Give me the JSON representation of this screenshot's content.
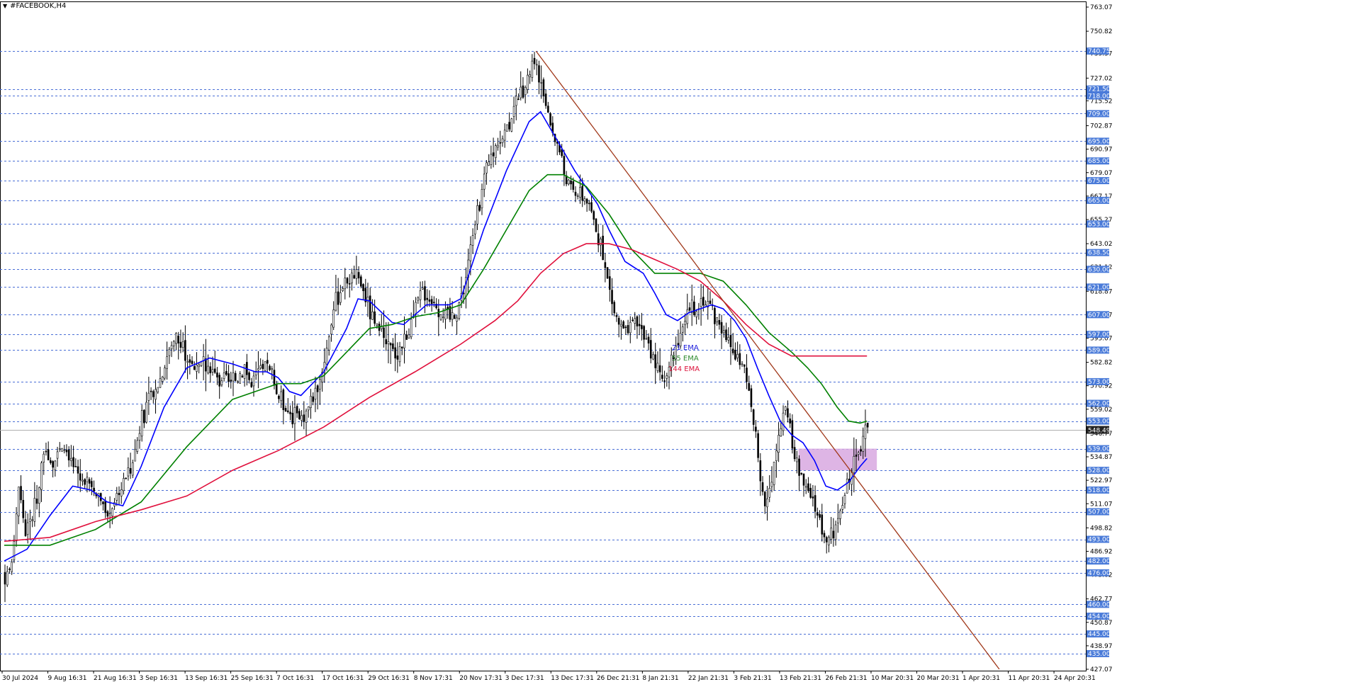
{
  "window": {
    "title": "#FACEBOOK,H4",
    "menu_icon": "triangle-down-icon"
  },
  "chart_data": {
    "type": "candlestick",
    "symbol": "#FACEBOOK",
    "timeframe": "H4",
    "current_price": "548.49",
    "ylim": [
      427.07,
      763.07
    ],
    "price_scale_ticks": [
      "763.07",
      "750.82",
      "739.57",
      "727.02",
      "715.52",
      "702.87",
      "690.97",
      "679.07",
      "667.17",
      "655.27",
      "643.02",
      "631.12",
      "618.87",
      "606.97",
      "595.07",
      "582.82",
      "570.92",
      "559.02",
      "546.77",
      "534.87",
      "522.97",
      "511.07",
      "498.82",
      "486.92",
      "475.02",
      "462.77",
      "450.87",
      "438.97",
      "427.07"
    ],
    "price_scale_tick_values": [
      763.07,
      750.82,
      739.57,
      727.02,
      715.52,
      702.87,
      690.97,
      679.07,
      667.17,
      655.27,
      643.02,
      631.12,
      618.87,
      606.97,
      595.07,
      582.82,
      570.92,
      559.02,
      546.77,
      534.87,
      522.97,
      511.07,
      498.82,
      486.92,
      475.02,
      462.77,
      450.87,
      438.97,
      427.07
    ],
    "horizontal_levels": [
      "740.75",
      "721.50",
      "718.00",
      "709.00",
      "695.00",
      "685.00",
      "675.00",
      "665.00",
      "653.00",
      "638.50",
      "630.00",
      "621.00",
      "607.00",
      "597.00",
      "589.00",
      "573.00",
      "562.00",
      "553.00",
      "539.00",
      "528.00",
      "518.00",
      "507.00",
      "493.00",
      "482.00",
      "476.00",
      "460.00",
      "454.00",
      "445.00",
      "435.00"
    ],
    "horizontal_level_values": [
      740.75,
      721.5,
      718.0,
      709.0,
      695.0,
      685.0,
      675.0,
      665.0,
      653.0,
      638.5,
      630.0,
      621.0,
      607.0,
      597.0,
      589.0,
      573.0,
      562.0,
      553.0,
      539.0,
      528.0,
      518.0,
      507.0,
      493.0,
      482.0,
      476.0,
      460.0,
      454.0,
      445.0,
      435.0
    ],
    "time_labels": [
      "30 Jul 2024",
      "9 Aug 16:31",
      "21 Aug 16:31",
      "3 Sep 16:31",
      "13 Sep 16:31",
      "25 Sep 16:31",
      "7 Oct 16:31",
      "17 Oct 16:31",
      "29 Oct 16:31",
      "8 Nov 17:31",
      "20 Nov 17:31",
      "3 Dec 17:31",
      "13 Dec 17:31",
      "26 Dec 21:31",
      "8 Jan 21:31",
      "22 Jan 21:31",
      "3 Feb 21:31",
      "13 Feb 21:31",
      "26 Feb 21:31",
      "10 Mar 20:31",
      "20 Mar 20:31",
      "1 Apr 20:31",
      "11 Apr 20:31",
      "24 Apr 20:31"
    ],
    "price_path": [
      [
        0,
        475
      ],
      [
        3,
        480
      ],
      [
        6,
        520
      ],
      [
        9,
        497
      ],
      [
        12,
        505
      ],
      [
        15,
        520
      ],
      [
        18,
        540
      ],
      [
        21,
        532
      ],
      [
        24,
        538
      ],
      [
        27,
        535
      ],
      [
        30,
        528
      ],
      [
        33,
        524
      ],
      [
        36,
        522
      ],
      [
        39,
        518
      ],
      [
        42,
        510
      ],
      [
        45,
        505
      ],
      [
        48,
        514
      ],
      [
        51,
        520
      ],
      [
        54,
        528
      ],
      [
        57,
        538
      ],
      [
        60,
        555
      ],
      [
        63,
        562
      ],
      [
        66,
        568
      ],
      [
        69,
        578
      ],
      [
        72,
        590
      ],
      [
        75,
        596
      ],
      [
        78,
        590
      ],
      [
        81,
        584
      ],
      [
        84,
        578
      ],
      [
        87,
        582
      ],
      [
        90,
        580
      ],
      [
        93,
        574
      ],
      [
        96,
        575
      ],
      [
        99,
        572
      ],
      [
        102,
        575
      ],
      [
        105,
        582
      ],
      [
        108,
        570
      ],
      [
        111,
        578
      ],
      [
        114,
        582
      ],
      [
        117,
        575
      ],
      [
        120,
        565
      ],
      [
        123,
        560
      ],
      [
        126,
        556
      ],
      [
        129,
        554
      ],
      [
        132,
        558
      ],
      [
        135,
        565
      ],
      [
        138,
        575
      ],
      [
        141,
        590
      ],
      [
        144,
        610
      ],
      [
        147,
        620
      ],
      [
        150,
        625
      ],
      [
        153,
        628
      ],
      [
        156,
        622
      ],
      [
        159,
        612
      ],
      [
        162,
        600
      ],
      [
        165,
        595
      ],
      [
        168,
        590
      ],
      [
        171,
        588
      ],
      [
        174,
        592
      ],
      [
        177,
        598
      ],
      [
        180,
        610
      ],
      [
        183,
        620
      ],
      [
        186,
        615
      ],
      [
        189,
        612
      ],
      [
        192,
        608
      ],
      [
        195,
        605
      ],
      [
        198,
        610
      ],
      [
        201,
        620
      ],
      [
        204,
        640
      ],
      [
        207,
        660
      ],
      [
        210,
        675
      ],
      [
        213,
        688
      ],
      [
        216,
        695
      ],
      [
        219,
        700
      ],
      [
        222,
        708
      ],
      [
        225,
        715
      ],
      [
        228,
        722
      ],
      [
        231,
        735
      ],
      [
        234,
        728
      ],
      [
        237,
        710
      ],
      [
        240,
        700
      ],
      [
        243,
        690
      ],
      [
        246,
        675
      ],
      [
        249,
        670
      ],
      [
        252,
        668
      ],
      [
        255,
        665
      ],
      [
        258,
        655
      ],
      [
        261,
        640
      ],
      [
        264,
        625
      ],
      [
        267,
        608
      ],
      [
        270,
        600
      ],
      [
        273,
        598
      ],
      [
        276,
        604
      ],
      [
        279,
        600
      ],
      [
        282,
        590
      ],
      [
        285,
        582
      ],
      [
        288,
        575
      ],
      [
        291,
        580
      ],
      [
        294,
        590
      ],
      [
        297,
        598
      ],
      [
        300,
        610
      ],
      [
        303,
        612
      ],
      [
        306,
        615
      ],
      [
        309,
        612
      ],
      [
        312,
        605
      ],
      [
        315,
        600
      ],
      [
        318,
        590
      ],
      [
        321,
        585
      ],
      [
        324,
        580
      ],
      [
        327,
        560
      ],
      [
        330,
        535
      ],
      [
        333,
        510
      ],
      [
        336,
        520
      ],
      [
        339,
        548
      ],
      [
        342,
        562
      ],
      [
        345,
        540
      ],
      [
        348,
        528
      ],
      [
        351,
        518
      ],
      [
        354,
        512
      ],
      [
        357,
        502
      ],
      [
        360,
        492
      ],
      [
        363,
        497
      ],
      [
        366,
        505
      ],
      [
        369,
        522
      ],
      [
        372,
        532
      ],
      [
        375,
        540
      ],
      [
        378,
        548.49
      ]
    ],
    "candle_count": 379,
    "series": [
      {
        "name": "21 EMA",
        "color": "#0000ff",
        "values": [
          [
            0,
            482
          ],
          [
            10,
            488
          ],
          [
            20,
            505
          ],
          [
            30,
            520
          ],
          [
            38,
            518
          ],
          [
            45,
            512
          ],
          [
            52,
            510
          ],
          [
            60,
            530
          ],
          [
            70,
            560
          ],
          [
            80,
            580
          ],
          [
            90,
            585
          ],
          [
            100,
            582
          ],
          [
            110,
            578
          ],
          [
            115,
            578
          ],
          [
            120,
            575
          ],
          [
            125,
            568
          ],
          [
            130,
            566
          ],
          [
            140,
            578
          ],
          [
            150,
            600
          ],
          [
            155,
            615
          ],
          [
            160,
            614
          ],
          [
            170,
            603
          ],
          [
            175,
            602
          ],
          [
            185,
            612
          ],
          [
            195,
            612
          ],
          [
            200,
            615
          ],
          [
            210,
            650
          ],
          [
            220,
            680
          ],
          [
            230,
            705
          ],
          [
            235,
            710
          ],
          [
            240,
            700
          ],
          [
            250,
            680
          ],
          [
            260,
            663
          ],
          [
            265,
            650
          ],
          [
            272,
            634
          ],
          [
            280,
            628
          ],
          [
            285,
            618
          ],
          [
            290,
            607
          ],
          [
            295,
            604
          ],
          [
            300,
            608
          ],
          [
            305,
            610
          ],
          [
            310,
            612
          ],
          [
            315,
            610
          ],
          [
            320,
            604
          ],
          [
            325,
            595
          ],
          [
            330,
            580
          ],
          [
            335,
            566
          ],
          [
            340,
            553
          ],
          [
            345,
            546
          ],
          [
            350,
            542
          ],
          [
            355,
            533
          ],
          [
            360,
            520
          ],
          [
            365,
            518
          ],
          [
            370,
            522
          ],
          [
            375,
            530
          ],
          [
            378,
            534
          ]
        ]
      },
      {
        "name": "55 EMA",
        "color": "#008000",
        "values": [
          [
            0,
            490
          ],
          [
            20,
            490
          ],
          [
            40,
            498
          ],
          [
            60,
            512
          ],
          [
            80,
            540
          ],
          [
            100,
            564
          ],
          [
            120,
            572
          ],
          [
            130,
            572
          ],
          [
            140,
            576
          ],
          [
            150,
            588
          ],
          [
            160,
            600
          ],
          [
            170,
            602
          ],
          [
            180,
            606
          ],
          [
            190,
            608
          ],
          [
            200,
            612
          ],
          [
            210,
            630
          ],
          [
            220,
            650
          ],
          [
            230,
            670
          ],
          [
            238,
            678
          ],
          [
            245,
            678
          ],
          [
            255,
            672
          ],
          [
            265,
            658
          ],
          [
            275,
            640
          ],
          [
            285,
            628
          ],
          [
            295,
            628
          ],
          [
            305,
            628
          ],
          [
            315,
            624
          ],
          [
            325,
            612
          ],
          [
            335,
            598
          ],
          [
            345,
            588
          ],
          [
            352,
            580
          ],
          [
            358,
            572
          ],
          [
            365,
            560
          ],
          [
            370,
            553
          ],
          [
            375,
            552
          ],
          [
            378,
            553
          ]
        ]
      },
      {
        "name": "144 EMA",
        "color": "#e0103c",
        "values": [
          [
            0,
            492
          ],
          [
            20,
            494
          ],
          [
            40,
            502
          ],
          [
            60,
            508
          ],
          [
            80,
            515
          ],
          [
            100,
            528
          ],
          [
            120,
            538
          ],
          [
            140,
            550
          ],
          [
            160,
            565
          ],
          [
            180,
            578
          ],
          [
            200,
            592
          ],
          [
            215,
            604
          ],
          [
            225,
            614
          ],
          [
            235,
            628
          ],
          [
            245,
            638
          ],
          [
            255,
            643
          ],
          [
            265,
            643
          ],
          [
            275,
            640
          ],
          [
            285,
            635
          ],
          [
            295,
            630
          ],
          [
            305,
            624
          ],
          [
            315,
            614
          ],
          [
            325,
            602
          ],
          [
            335,
            592
          ],
          [
            345,
            586
          ],
          [
            350,
            586
          ],
          [
            378,
            586
          ]
        ]
      }
    ],
    "trendline": {
      "from": [
        233,
        740.75
      ],
      "to": [
        436,
        427.07
      ],
      "color": "#a0381a"
    },
    "zone": {
      "x_start": 348,
      "x_end": 378,
      "y_top": 539,
      "y_bottom": 528,
      "color": "#d8a8e0"
    },
    "legend": [
      {
        "label": "21 EMA",
        "color": "#1a1adc"
      },
      {
        "label": "55 EMA",
        "color": "#2e8b2e"
      },
      {
        "label": "144 EMA",
        "color": "#dc143c"
      }
    ],
    "colors": {
      "background": "#ffffff",
      "candle": "#000000",
      "grid_dash": "#4a6fd6",
      "level_label_bg": "#4a7bd9",
      "level_label_text": "#ffffff",
      "price_label_bg": "#222222"
    }
  }
}
